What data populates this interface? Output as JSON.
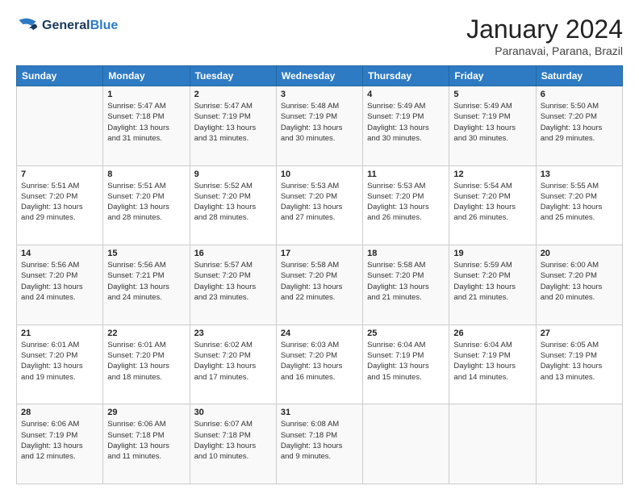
{
  "logo": {
    "line1": "General",
    "line2": "Blue"
  },
  "title": "January 2024",
  "subtitle": "Paranavai, Parana, Brazil",
  "weekdays": [
    "Sunday",
    "Monday",
    "Tuesday",
    "Wednesday",
    "Thursday",
    "Friday",
    "Saturday"
  ],
  "weeks": [
    [
      {
        "day": "",
        "info": ""
      },
      {
        "day": "1",
        "info": "Sunrise: 5:47 AM\nSunset: 7:18 PM\nDaylight: 13 hours\nand 31 minutes."
      },
      {
        "day": "2",
        "info": "Sunrise: 5:47 AM\nSunset: 7:19 PM\nDaylight: 13 hours\nand 31 minutes."
      },
      {
        "day": "3",
        "info": "Sunrise: 5:48 AM\nSunset: 7:19 PM\nDaylight: 13 hours\nand 30 minutes."
      },
      {
        "day": "4",
        "info": "Sunrise: 5:49 AM\nSunset: 7:19 PM\nDaylight: 13 hours\nand 30 minutes."
      },
      {
        "day": "5",
        "info": "Sunrise: 5:49 AM\nSunset: 7:19 PM\nDaylight: 13 hours\nand 30 minutes."
      },
      {
        "day": "6",
        "info": "Sunrise: 5:50 AM\nSunset: 7:20 PM\nDaylight: 13 hours\nand 29 minutes."
      }
    ],
    [
      {
        "day": "7",
        "info": "Sunrise: 5:51 AM\nSunset: 7:20 PM\nDaylight: 13 hours\nand 29 minutes."
      },
      {
        "day": "8",
        "info": "Sunrise: 5:51 AM\nSunset: 7:20 PM\nDaylight: 13 hours\nand 28 minutes."
      },
      {
        "day": "9",
        "info": "Sunrise: 5:52 AM\nSunset: 7:20 PM\nDaylight: 13 hours\nand 28 minutes."
      },
      {
        "day": "10",
        "info": "Sunrise: 5:53 AM\nSunset: 7:20 PM\nDaylight: 13 hours\nand 27 minutes."
      },
      {
        "day": "11",
        "info": "Sunrise: 5:53 AM\nSunset: 7:20 PM\nDaylight: 13 hours\nand 26 minutes."
      },
      {
        "day": "12",
        "info": "Sunrise: 5:54 AM\nSunset: 7:20 PM\nDaylight: 13 hours\nand 26 minutes."
      },
      {
        "day": "13",
        "info": "Sunrise: 5:55 AM\nSunset: 7:20 PM\nDaylight: 13 hours\nand 25 minutes."
      }
    ],
    [
      {
        "day": "14",
        "info": "Sunrise: 5:56 AM\nSunset: 7:20 PM\nDaylight: 13 hours\nand 24 minutes."
      },
      {
        "day": "15",
        "info": "Sunrise: 5:56 AM\nSunset: 7:21 PM\nDaylight: 13 hours\nand 24 minutes."
      },
      {
        "day": "16",
        "info": "Sunrise: 5:57 AM\nSunset: 7:20 PM\nDaylight: 13 hours\nand 23 minutes."
      },
      {
        "day": "17",
        "info": "Sunrise: 5:58 AM\nSunset: 7:20 PM\nDaylight: 13 hours\nand 22 minutes."
      },
      {
        "day": "18",
        "info": "Sunrise: 5:58 AM\nSunset: 7:20 PM\nDaylight: 13 hours\nand 21 minutes."
      },
      {
        "day": "19",
        "info": "Sunrise: 5:59 AM\nSunset: 7:20 PM\nDaylight: 13 hours\nand 21 minutes."
      },
      {
        "day": "20",
        "info": "Sunrise: 6:00 AM\nSunset: 7:20 PM\nDaylight: 13 hours\nand 20 minutes."
      }
    ],
    [
      {
        "day": "21",
        "info": "Sunrise: 6:01 AM\nSunset: 7:20 PM\nDaylight: 13 hours\nand 19 minutes."
      },
      {
        "day": "22",
        "info": "Sunrise: 6:01 AM\nSunset: 7:20 PM\nDaylight: 13 hours\nand 18 minutes."
      },
      {
        "day": "23",
        "info": "Sunrise: 6:02 AM\nSunset: 7:20 PM\nDaylight: 13 hours\nand 17 minutes."
      },
      {
        "day": "24",
        "info": "Sunrise: 6:03 AM\nSunset: 7:20 PM\nDaylight: 13 hours\nand 16 minutes."
      },
      {
        "day": "25",
        "info": "Sunrise: 6:04 AM\nSunset: 7:19 PM\nDaylight: 13 hours\nand 15 minutes."
      },
      {
        "day": "26",
        "info": "Sunrise: 6:04 AM\nSunset: 7:19 PM\nDaylight: 13 hours\nand 14 minutes."
      },
      {
        "day": "27",
        "info": "Sunrise: 6:05 AM\nSunset: 7:19 PM\nDaylight: 13 hours\nand 13 minutes."
      }
    ],
    [
      {
        "day": "28",
        "info": "Sunrise: 6:06 AM\nSunset: 7:19 PM\nDaylight: 13 hours\nand 12 minutes."
      },
      {
        "day": "29",
        "info": "Sunrise: 6:06 AM\nSunset: 7:18 PM\nDaylight: 13 hours\nand 11 minutes."
      },
      {
        "day": "30",
        "info": "Sunrise: 6:07 AM\nSunset: 7:18 PM\nDaylight: 13 hours\nand 10 minutes."
      },
      {
        "day": "31",
        "info": "Sunrise: 6:08 AM\nSunset: 7:18 PM\nDaylight: 13 hours\nand 9 minutes."
      },
      {
        "day": "",
        "info": ""
      },
      {
        "day": "",
        "info": ""
      },
      {
        "day": "",
        "info": ""
      }
    ]
  ]
}
